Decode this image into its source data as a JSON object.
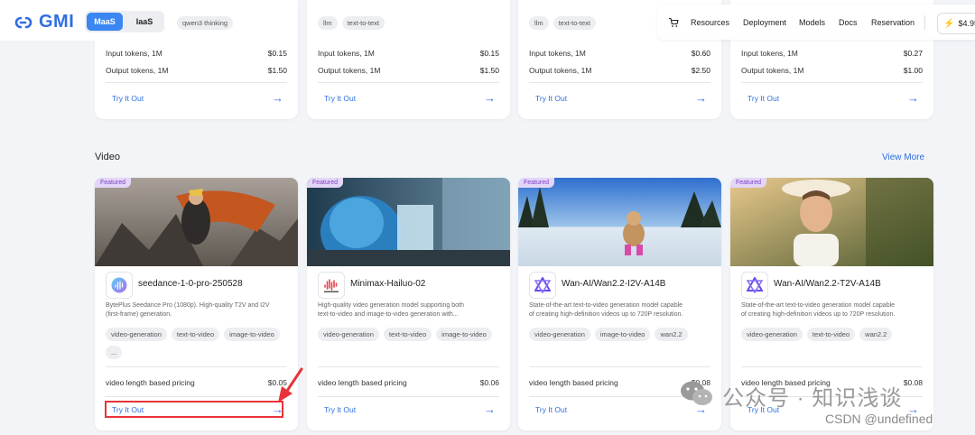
{
  "header": {
    "logo_text": "GMI",
    "segments": [
      "MaaS",
      "IaaS"
    ],
    "active_segment": "MaaS",
    "top_chip": "qwen3 thinking"
  },
  "nav": {
    "items": [
      "Resources",
      "Deployment",
      "Models",
      "Docs",
      "Reservation"
    ],
    "balance": "$4.95",
    "cart_icon": "cart-icon",
    "bolt_icon": "bolt-icon"
  },
  "llm_cards": [
    {
      "chips": [],
      "input_label": "Input tokens, 1M",
      "input_price": "$0.15",
      "output_label": "Output tokens, 1M",
      "output_price": "$1.50",
      "cta": "Try It Out"
    },
    {
      "chips": [
        "llm",
        "text-to-text"
      ],
      "input_label": "Input tokens, 1M",
      "input_price": "$0.15",
      "output_label": "Output tokens, 1M",
      "output_price": "$1.50",
      "cta": "Try It Out"
    },
    {
      "chips": [
        "llm",
        "text-to-text"
      ],
      "input_label": "Input tokens, 1M",
      "input_price": "$0.60",
      "output_label": "Output tokens, 1M",
      "output_price": "$2.50",
      "cta": "Try It Out"
    },
    {
      "chips": [],
      "input_label": "Input tokens, 1M",
      "input_price": "$0.27",
      "output_label": "Output tokens, 1M",
      "output_price": "$1.00",
      "cta": "Try It Out"
    }
  ],
  "video_section": {
    "title": "Video",
    "view_more": "View More"
  },
  "video_cards": [
    {
      "badge": "Featured",
      "name": "seedance-1-0-pro-250528",
      "icon": "seedance-icon",
      "desc_line1": "BytePlus Seedance Pro (1080p). High-quality T2V and I2V",
      "desc_line2": "(first-frame) generation.",
      "tags": [
        "video-generation",
        "text-to-video",
        "image-to-video",
        "..."
      ],
      "pricing_label": "video length based pricing",
      "price": "$0.05",
      "cta": "Try It Out"
    },
    {
      "badge": "Featured",
      "name": "Minimax-Hailuo-02",
      "icon": "minimax-icon",
      "desc_line1": "High-quality video generation model supporting both",
      "desc_line2": "text-to-video and image-to-video generation with...",
      "tags": [
        "video-generation",
        "text-to-video",
        "image-to-video"
      ],
      "pricing_label": "video length based pricing",
      "price": "$0.06",
      "cta": "Try It Out"
    },
    {
      "badge": "Featured",
      "name": "Wan-AI/Wan2.2-I2V-A14B",
      "icon": "wan-icon",
      "desc_line1": "State-of-the-art text-to-video generation model capable",
      "desc_line2": "of creating high-definition videos up to 720P resolution.",
      "tags": [
        "video-generation",
        "image-to-video",
        "wan2.2"
      ],
      "pricing_label": "video length based pricing",
      "price": "$0.08",
      "cta": "Try It Out"
    },
    {
      "badge": "Featured",
      "name": "Wan-AI/Wan2.2-T2V-A14B",
      "icon": "wan-icon",
      "desc_line1": "State-of-the-art text-to-video generation model capable",
      "desc_line2": "of creating high-definition videos up to 720P resolution.",
      "tags": [
        "video-generation",
        "text-to-video",
        "wan2.2"
      ],
      "pricing_label": "video length based pricing",
      "price": "$0.08",
      "cta": "Try It Out"
    }
  ],
  "watermark": {
    "line1": "公众号 · 知识浅谈",
    "line2": "CSDN @undefined"
  },
  "colors": {
    "accent": "#2f6fe0",
    "segment_active": "#3a86f2",
    "featured_badge": "#e4d6f7",
    "annotation_red": "#e8333a"
  }
}
